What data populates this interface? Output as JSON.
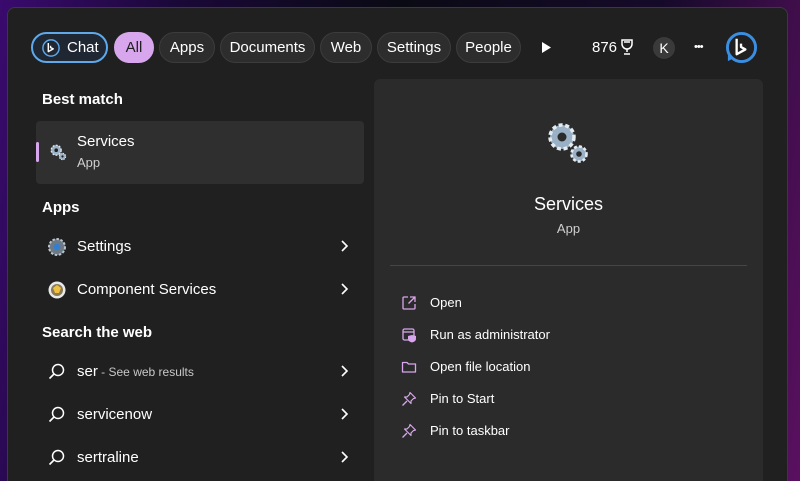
{
  "filters": {
    "chat": "Chat",
    "all": "All",
    "apps": "Apps",
    "documents": "Documents",
    "web": "Web",
    "settings": "Settings",
    "people": "People"
  },
  "topbar": {
    "points": "876",
    "account_initial": "K",
    "more": "•••"
  },
  "best_match": {
    "title": "Best match",
    "name": "Services",
    "type": "App"
  },
  "apps_section": {
    "title": "Apps",
    "items": [
      {
        "label": "Settings"
      },
      {
        "label": "Component Services"
      }
    ]
  },
  "web_section": {
    "title": "Search the web",
    "items": [
      {
        "label": "ser",
        "hint": " - See web results"
      },
      {
        "label": "servicenow"
      },
      {
        "label": "sertraline"
      }
    ]
  },
  "detail": {
    "name": "Services",
    "type": "App",
    "actions": [
      {
        "label": "Open",
        "icon": "open-external-icon"
      },
      {
        "label": "Run as administrator",
        "icon": "shield-icon"
      },
      {
        "label": "Open file location",
        "icon": "folder-icon"
      },
      {
        "label": "Pin to Start",
        "icon": "pin-icon"
      },
      {
        "label": "Pin to taskbar",
        "icon": "pin-icon"
      }
    ]
  },
  "colors": {
    "accent": "#d8a6ec",
    "chat_border": "#5fa8ea",
    "panel": "#202020",
    "detail_panel": "#2b2b2b"
  }
}
